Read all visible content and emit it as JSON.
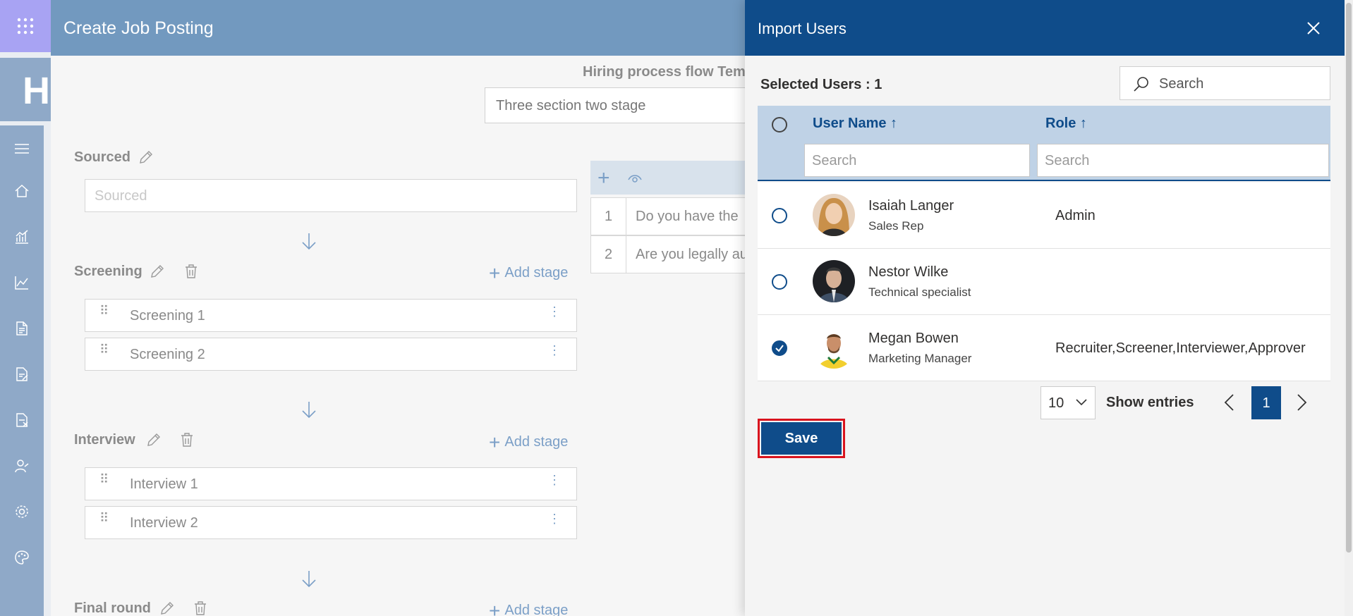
{
  "app": {
    "brand_text": "HI"
  },
  "job_posting": {
    "title": "Create Job Posting",
    "hiring_flow_label": "Hiring process flow Tem",
    "hiring_flow_value": "Three section two stage",
    "add_stage_label": "Add stage",
    "sections": [
      {
        "title": "Sourced",
        "placeholder": "Sourced"
      },
      {
        "title": "Screening",
        "stages": [
          "Screening 1",
          "Screening 2"
        ]
      },
      {
        "title": "Interview",
        "stages": [
          "Interview 1",
          "Interview 2"
        ]
      },
      {
        "title": "Final round"
      }
    ],
    "questions": [
      {
        "num": "1",
        "text": "Do you have the"
      },
      {
        "num": "2",
        "text": "Are you legally au"
      }
    ]
  },
  "import_users": {
    "title": "Import Users",
    "selected_label": "Selected Users : 1",
    "search_placeholder": "Search",
    "columns": {
      "user_name": "User Name ↑",
      "role": "Role ↑"
    },
    "column_search_placeholder": "Search",
    "users": [
      {
        "name": "Isaiah Langer",
        "title": "Sales Rep",
        "role": "Admin",
        "checked": false
      },
      {
        "name": "Nestor Wilke",
        "title": "Technical specialist",
        "role": "",
        "checked": false
      },
      {
        "name": "Megan Bowen",
        "title": "Marketing Manager",
        "role": "Recruiter,Screener,Interviewer,Approver",
        "checked": true
      }
    ],
    "page_size": "10",
    "show_entries_label": "Show entries",
    "current_page": "1",
    "save_label": "Save"
  },
  "colors": {
    "header_blue": "#0f4c8a",
    "job_header": "#7299bf",
    "highlight_red": "#d9141e",
    "waffle_purple": "#a8a3f3"
  }
}
